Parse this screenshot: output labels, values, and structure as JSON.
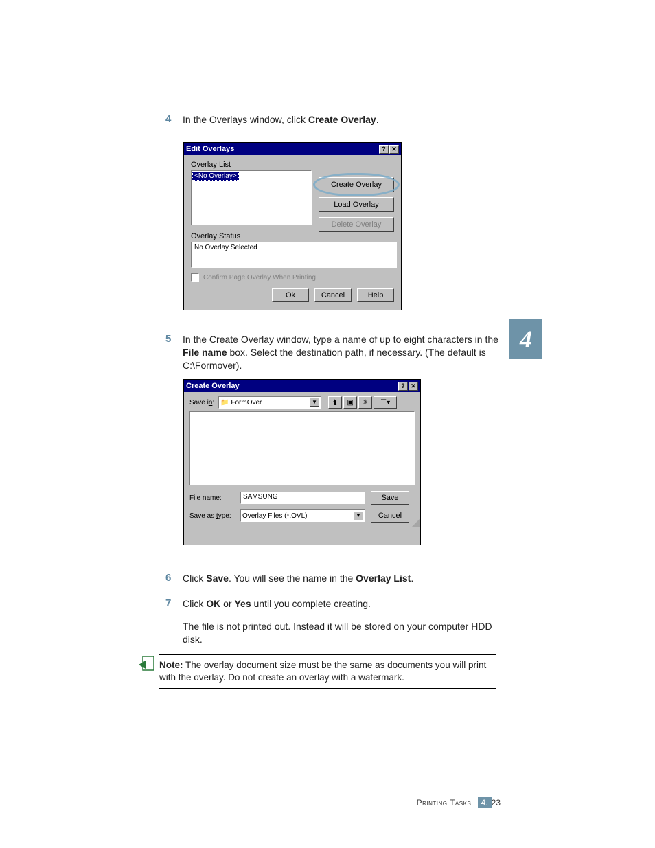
{
  "steps": {
    "s4": {
      "num": "4",
      "pre": "In the Overlays window, click ",
      "bold": "Create Overlay",
      "post": "."
    },
    "s5": {
      "num": "5",
      "pre": "In the Create Overlay window, type a name of up to eight characters in the ",
      "bold": "File name",
      "post": " box. Select the destination path, if necessary. (The default is C:\\Formover)."
    },
    "s6": {
      "num": "6",
      "t1": "Click ",
      "b1": "Save",
      "t2": ". You will see the name in the ",
      "b2": "Overlay List",
      "t3": "."
    },
    "s7": {
      "num": "7",
      "t1": "Click ",
      "b1": "OK",
      "t2": " or ",
      "b2": "Yes",
      "t3": " until you complete creating.",
      "para": "The file is not printed out. Instead it will be stored on your computer HDD disk."
    }
  },
  "dlg1": {
    "title": "Edit Overlays",
    "overlay_list_label": "Overlay List",
    "no_overlay": "<No Overlay>",
    "create": "Create Overlay",
    "load": "Load Overlay",
    "delete": "Delete Overlay",
    "status_label": "Overlay Status",
    "status_text": "No Overlay Selected",
    "confirm": "Confirm Page Overlay When Printing",
    "ok": "Ok",
    "cancel": "Cancel",
    "help": "Help"
  },
  "dlg2": {
    "title": "Create Overlay",
    "save_in": "Save in:",
    "folder": "FormOver",
    "file_name_lbl": "File name:",
    "file_name_val": "SAMSUNG",
    "save_as_type_lbl": "Save as type:",
    "save_as_type_val": "Overlay Files (*.OVL)",
    "save": "Save",
    "cancel": "Cancel"
  },
  "note": {
    "label": "Note:",
    "text": " The overlay document size must be the same as documents you will print with the overlay. Do not create an overlay with a watermark."
  },
  "chapter": "4",
  "footer": {
    "section": "Printing Tasks",
    "chapter": "4.",
    "page": "23"
  }
}
